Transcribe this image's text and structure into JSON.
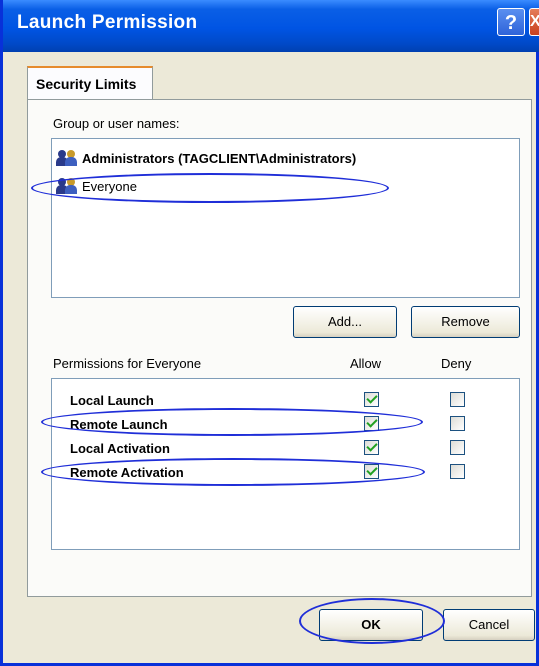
{
  "window": {
    "title": "Launch Permission",
    "help_label": "?",
    "close_label": "X"
  },
  "tabs": [
    {
      "label": "Security Limits"
    }
  ],
  "group_section": {
    "label": "Group or user names:",
    "items": [
      {
        "name": "Administrators (TAGCLIENT\\Administrators)",
        "icon": "user-group-icon"
      },
      {
        "name": "Everyone",
        "icon": "user-group-icon"
      }
    ],
    "add_label": "Add...",
    "remove_label": "Remove"
  },
  "permissions": {
    "label": "Permissions for Everyone",
    "allow_header": "Allow",
    "deny_header": "Deny",
    "rows": [
      {
        "label": "Local Launch",
        "allow": true,
        "deny": false
      },
      {
        "label": "Remote Launch",
        "allow": true,
        "deny": false
      },
      {
        "label": "Local Activation",
        "allow": true,
        "deny": false
      },
      {
        "label": "Remote Activation",
        "allow": true,
        "deny": false
      }
    ]
  },
  "footer": {
    "ok_label": "OK",
    "cancel_label": "Cancel"
  },
  "colors": {
    "titlebar": "#0054e3",
    "dialog_bg": "#ece9d8",
    "annotation_ellipse": "#1f2ed8",
    "checkmark": "#21a121"
  }
}
